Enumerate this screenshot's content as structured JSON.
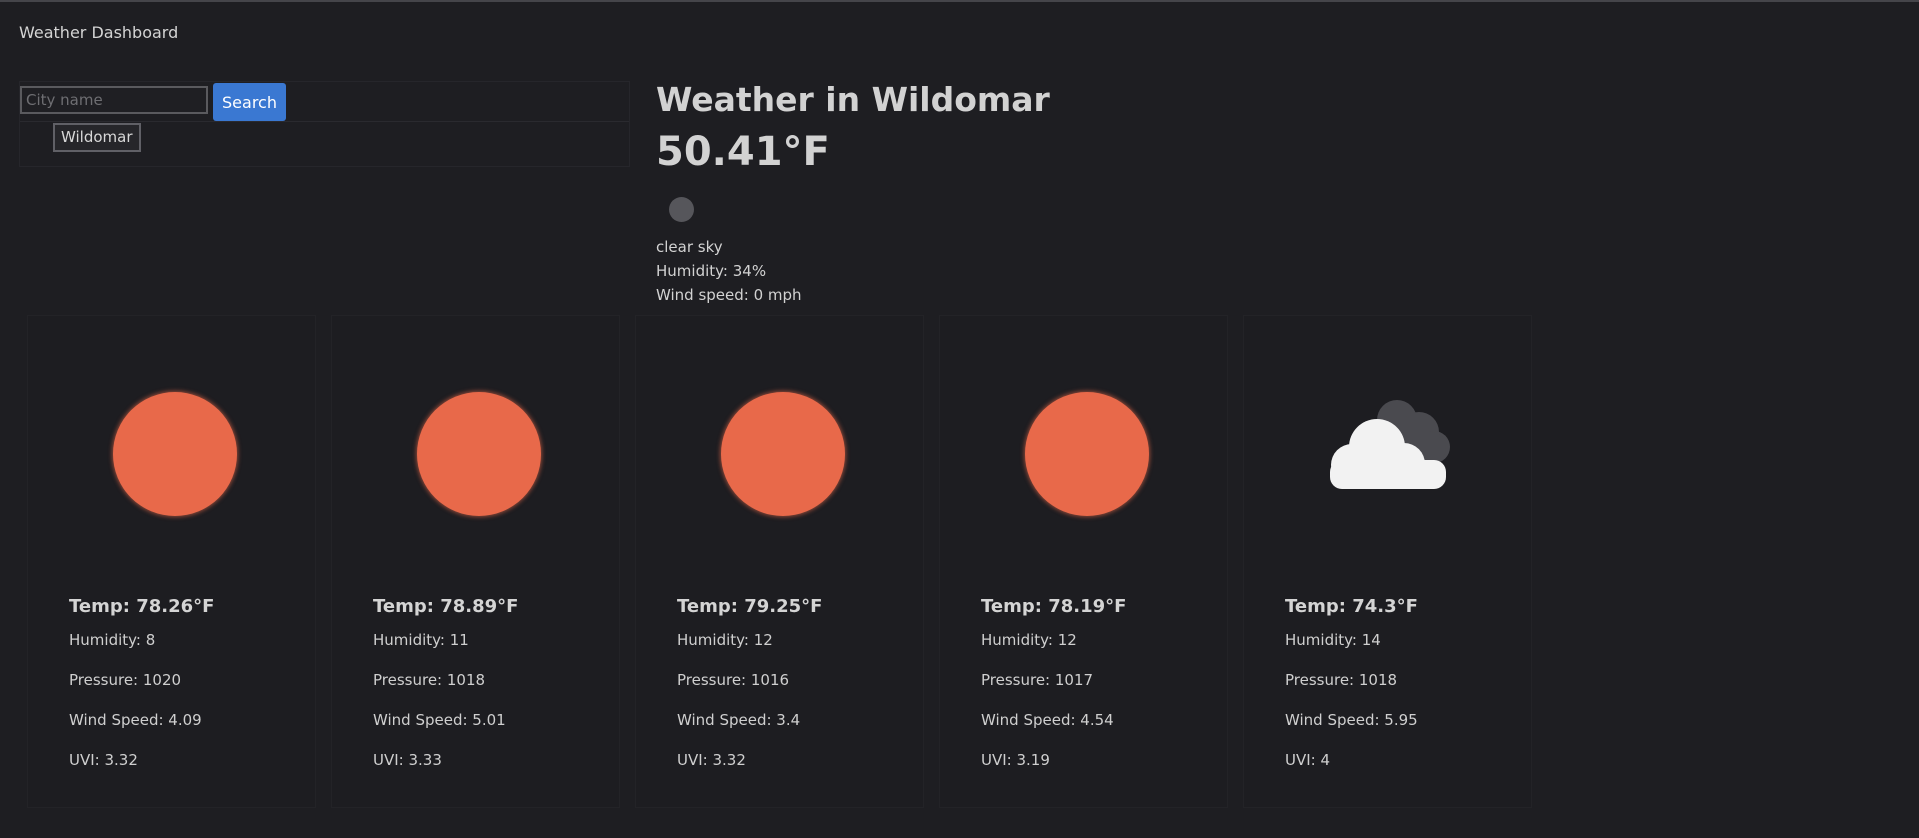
{
  "app_title": "Weather Dashboard",
  "search": {
    "placeholder": "City name",
    "value": "",
    "button_label": "Search"
  },
  "history": [
    {
      "label": "Wildomar"
    }
  ],
  "current": {
    "title": "Weather in Wildomar",
    "temp": "50.41°F",
    "icon": "weather-icon",
    "description": "clear sky",
    "humidity": "Humidity: 34%",
    "wind": "Wind speed: 0 mph"
  },
  "forecast": [
    {
      "icon": "sun-icon",
      "temp": "Temp: 78.26°F",
      "humidity": "Humidity: 8",
      "pressure": "Pressure: 1020",
      "wind": "Wind Speed: 4.09",
      "uvi": "UVI: 3.32"
    },
    {
      "icon": "sun-icon",
      "temp": "Temp: 78.89°F",
      "humidity": "Humidity: 11",
      "pressure": "Pressure: 1018",
      "wind": "Wind Speed: 5.01",
      "uvi": "UVI: 3.33"
    },
    {
      "icon": "sun-icon",
      "temp": "Temp: 79.25°F",
      "humidity": "Humidity: 12",
      "pressure": "Pressure: 1016",
      "wind": "Wind Speed: 3.4",
      "uvi": "UVI: 3.32"
    },
    {
      "icon": "sun-icon",
      "temp": "Temp: 78.19°F",
      "humidity": "Humidity: 12",
      "pressure": "Pressure: 1017",
      "wind": "Wind Speed: 4.54",
      "uvi": "UVI: 3.19"
    },
    {
      "icon": "partly-cloudy-icon",
      "temp": "Temp: 74.3°F",
      "humidity": "Humidity: 14",
      "pressure": "Pressure: 1018",
      "wind": "Wind Speed: 5.95",
      "uvi": "UVI: 4"
    }
  ],
  "colors": {
    "background": "#1e1e22",
    "accent": "#3a78d2",
    "sun": "#e8694a",
    "cloud": "#f2f2f2",
    "cloud_dark": "#4a4a4f"
  }
}
